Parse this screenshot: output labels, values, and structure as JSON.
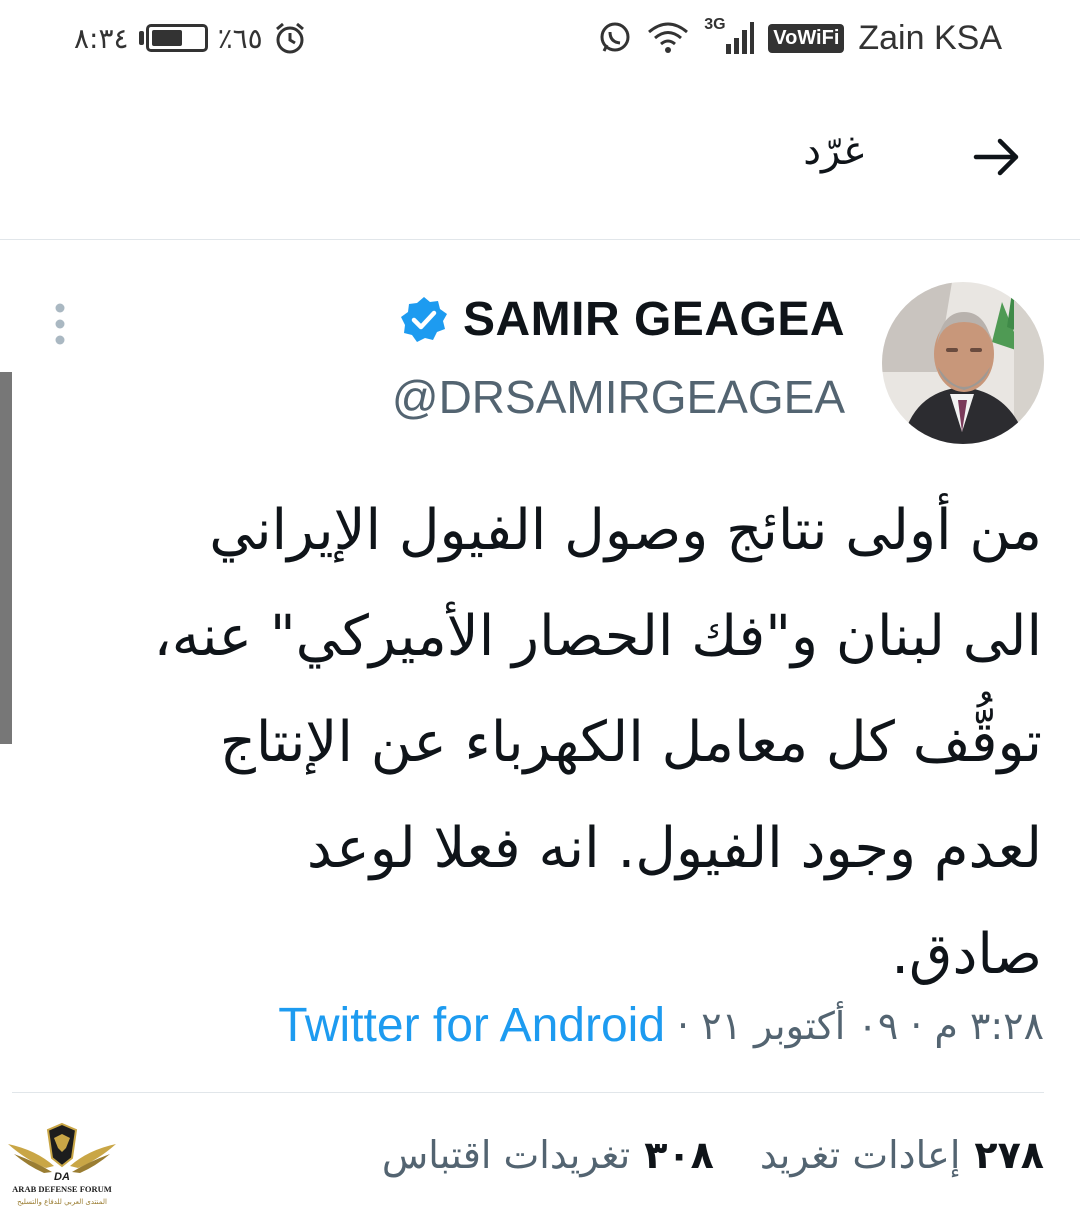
{
  "status_bar": {
    "time": "٨:٣٤",
    "battery": "٪٦٥",
    "battery_level": 0.65,
    "carrier": "Zain KSA",
    "network": "3G",
    "vowifi": "VoWiFi",
    "icons": [
      "alarm-icon",
      "battery-icon",
      "whatsapp-icon",
      "wifi-icon",
      "signal-icon"
    ]
  },
  "header": {
    "title": "غرّد",
    "back_icon": "arrow-right-icon"
  },
  "tweet": {
    "display_name": "SAMIR GEAGEA",
    "handle": "@DRSAMIRGEAGEA",
    "verified": true,
    "text": "من أولى نتائج وصول الفيول الإيراني\nالى لبنان و\"فك الحصار الأميركي\" عنه،\nتوقُّف كل معامل الكهرباء عن الإنتاج\nلعدم وجود الفيول. انه فعلا لوعد\nصادق.",
    "time": "٣:٢٨ م",
    "date": "٠٩ أكتوبر ٢١",
    "separator": "·",
    "source": "Twitter for Android",
    "retweets_count": "٢٧٨",
    "retweets_label": "إعادات تغريد",
    "quotes_count": "٣٠٨",
    "quotes_label": "تغريدات اقتباس"
  },
  "watermark": {
    "text": "ARAB DEFENSE FORUM",
    "subtext": "المنتدى العربي للدفاع والتسليح",
    "monogram": "DA"
  },
  "colors": {
    "link": "#1d9bf0",
    "secondary": "#536471",
    "primary_text": "#0f1419",
    "verified": "#1d9bf0"
  }
}
